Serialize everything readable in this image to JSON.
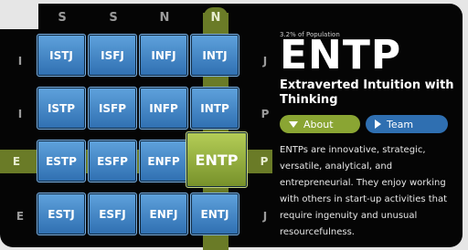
{
  "header": {
    "top_letters": [
      "S",
      "S",
      "N",
      "N"
    ],
    "side_letters": {
      "left": [
        "I",
        "I",
        "E",
        "E"
      ],
      "right": [
        "J",
        "P",
        "P",
        "J"
      ]
    }
  },
  "grid": {
    "rows": [
      [
        "ISTJ",
        "ISFJ",
        "INFJ",
        "INTJ"
      ],
      [
        "ISTP",
        "ISFP",
        "INFP",
        "INTP"
      ],
      [
        "ESTP",
        "ESFP",
        "ENFP",
        "ENTP"
      ],
      [
        "ESTJ",
        "ESFJ",
        "ENFJ",
        "ENTJ"
      ]
    ]
  },
  "detail": {
    "population": "3.2% of Population",
    "type": "ENTP",
    "subtitle": "Extraverted Intuition with Thinking",
    "buttons": {
      "about": "About",
      "team": "Team"
    },
    "description": "ENTPs are innovative, strategic, versatile, analytical, and entrepreneurial. They enjoy working with others in start-up activities that require ingenuity and unusual resourcefulness."
  },
  "colors": {
    "accent_green": "#8aa533",
    "tile_blue": "#3a7cc0",
    "highlight_green": "#6a7b27"
  }
}
